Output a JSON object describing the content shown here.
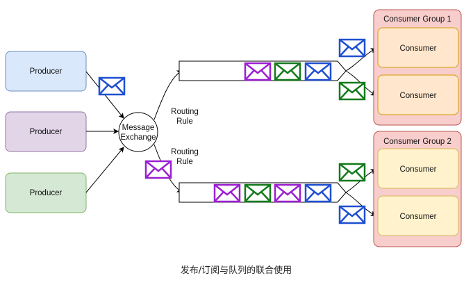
{
  "producers": [
    {
      "label": "Producer"
    },
    {
      "label": "Producer"
    },
    {
      "label": "Producer"
    }
  ],
  "exchange": {
    "line1": "Message",
    "line2": "Exchange"
  },
  "routing_rules": [
    {
      "line1": "Routing",
      "line2": "Rule"
    },
    {
      "line1": "Routing",
      "line2": "Rule"
    }
  ],
  "groups": [
    {
      "title": "Consumer Group 1",
      "consumers": [
        {
          "label": "Consumer"
        },
        {
          "label": "Consumer"
        }
      ]
    },
    {
      "title": "Consumer Group 2",
      "consumers": [
        {
          "label": "Consumer"
        },
        {
          "label": "Consumer"
        }
      ]
    }
  ],
  "caption": "发布/订阅与队列的联合使用",
  "colors": {
    "producer1_fill": "#dae8fc",
    "producer1_stroke": "#6c8ebf",
    "producer2_fill": "#e1d5e7",
    "producer2_stroke": "#9673a6",
    "producer3_fill": "#d5e8d4",
    "producer3_stroke": "#82b366",
    "group_fill": "#f8cecc",
    "group_stroke": "#b85450",
    "consumer1_fill": "#ffe6cc",
    "consumer1_stroke": "#d79b00",
    "consumer2_fill": "#fff2cc",
    "consumer2_stroke": "#d6b656",
    "msg_blue": "#1f4fd1",
    "msg_green": "#137a1b",
    "msg_purple": "#9b1fd1"
  },
  "queue1_messages": [
    "envelope-icon-purple",
    "envelope-icon-green",
    "envelope-icon-blue"
  ],
  "queue2_messages": [
    "envelope-icon-purple",
    "envelope-icon-green",
    "envelope-icon-purple",
    "envelope-icon-blue"
  ]
}
